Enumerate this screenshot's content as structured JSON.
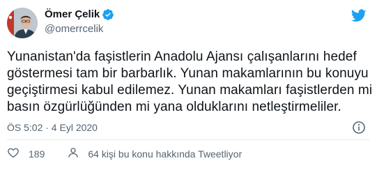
{
  "tweet": {
    "author": {
      "display_name": "Ömer Çelik",
      "handle": "@omerrcelik",
      "verified": true
    },
    "body_lines": [
      "Yunanistan'da faşistlerin Anadolu Ajansı çalışanlarını hedef",
      "göstermesi tam bir barbarlık. Yunan makamlarının bu konuyu",
      "geçiştirmesi kabul edilemez. Yunan makamları faşistlerden mi",
      "basın özgürlüğünden mi yana olduklarını netleştirmeliler."
    ],
    "timestamp": "ÖS 5:02 · 4 Eyl 2020",
    "likes": "189",
    "people_talking": "64 kişi bu konu hakkında Tweetliyor"
  },
  "icons": {
    "brand": "twitter-bird-icon",
    "verified": "verified-badge-icon",
    "info": "info-icon",
    "like": "heart-icon",
    "people": "person-icon"
  },
  "colors": {
    "brand_blue": "#1da1f2",
    "text_primary": "#0f1419",
    "text_secondary": "#536471",
    "divider": "#e6ecf0"
  }
}
